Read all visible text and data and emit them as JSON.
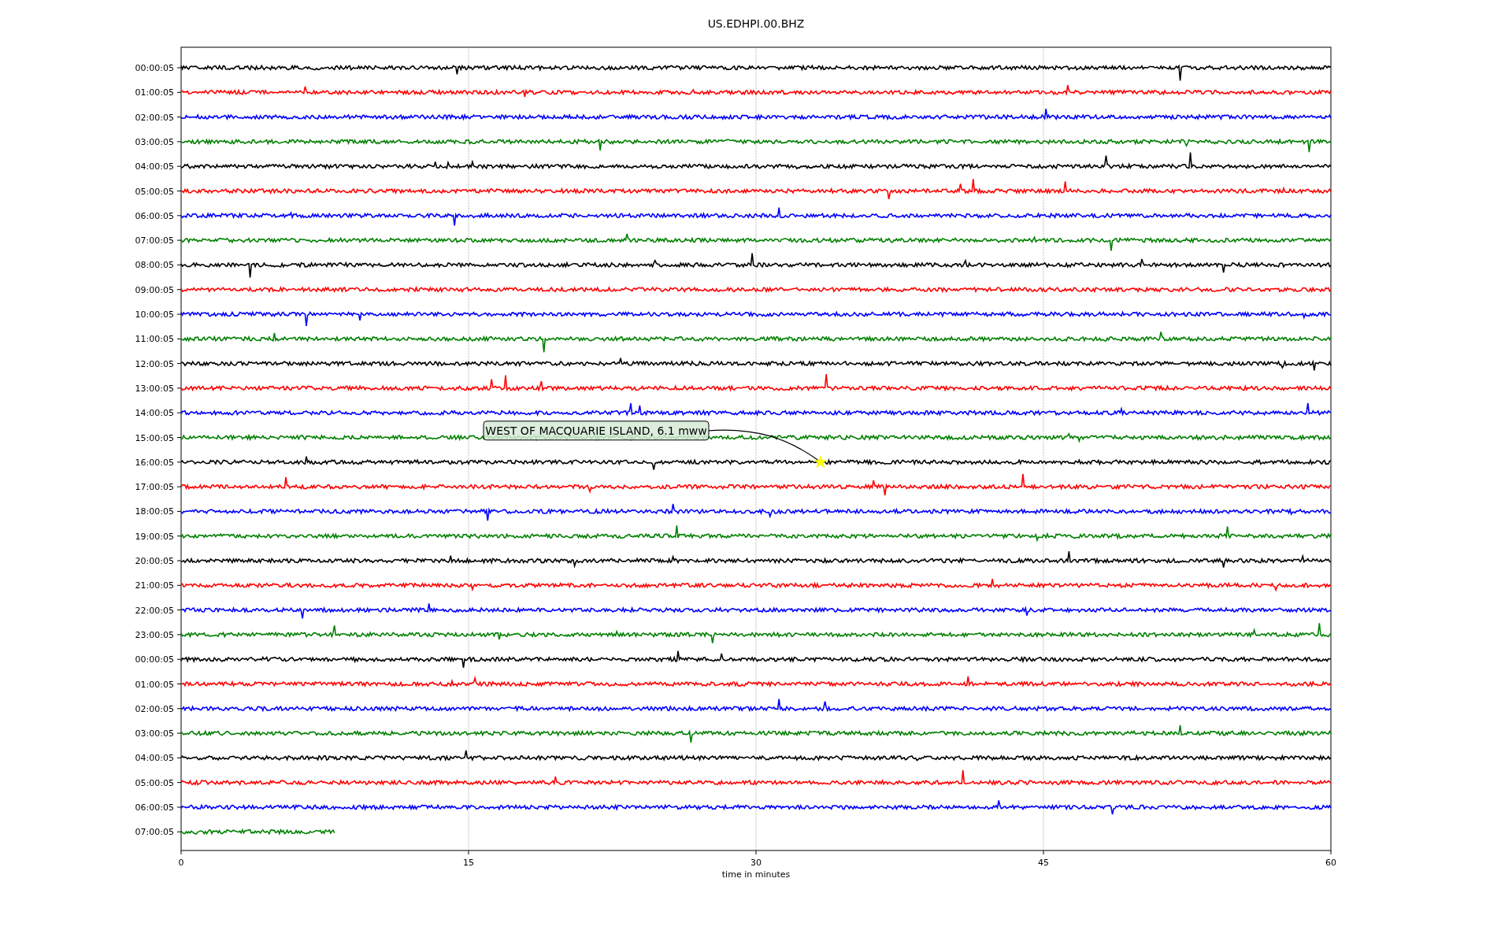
{
  "title": "US.EDHPI.00.BHZ",
  "xlabel": "time in minutes",
  "xticks": [
    "0",
    "15",
    "30",
    "45",
    "60"
  ],
  "traces": [
    {
      "label": "00:00:05",
      "color": "#000000",
      "level": 1
    },
    {
      "label": "01:00:05",
      "color": "#ff0000",
      "level": 1
    },
    {
      "label": "02:00:05",
      "color": "#0000ff",
      "level": 1
    },
    {
      "label": "03:00:05",
      "color": "#008000",
      "level": 1
    },
    {
      "label": "04:00:05",
      "color": "#000000",
      "level": 1
    },
    {
      "label": "05:00:05",
      "color": "#ff0000",
      "level": 1
    },
    {
      "label": "06:00:05",
      "color": "#0000ff",
      "level": 1
    },
    {
      "label": "07:00:05",
      "color": "#008000",
      "level": 1
    },
    {
      "label": "08:00:05",
      "color": "#000000",
      "level": 1
    },
    {
      "label": "09:00:05",
      "color": "#ff0000",
      "level": 1
    },
    {
      "label": "10:00:05",
      "color": "#0000ff",
      "level": 1
    },
    {
      "label": "11:00:05",
      "color": "#008000",
      "level": 1
    },
    {
      "label": "12:00:05",
      "color": "#000000",
      "level": 1
    },
    {
      "label": "13:00:05",
      "color": "#ff0000",
      "level": 1
    },
    {
      "label": "14:00:05",
      "color": "#0000ff",
      "level": 1
    },
    {
      "label": "15:00:05",
      "color": "#008000",
      "level": 1
    },
    {
      "label": "16:00:05",
      "color": "#000000",
      "level": 1,
      "event": "WEST OF MACQUARIE ISLAND, 6.1 mww"
    },
    {
      "label": "17:00:05",
      "color": "#ff0000",
      "level": 1
    },
    {
      "label": "18:00:05",
      "color": "#0000ff",
      "level": 1
    },
    {
      "label": "19:00:05",
      "color": "#008000",
      "level": 1
    },
    {
      "label": "20:00:05",
      "color": "#000000",
      "level": 1
    },
    {
      "label": "21:00:05",
      "color": "#ff0000",
      "level": 1
    },
    {
      "label": "22:00:05",
      "color": "#0000ff",
      "level": 1
    },
    {
      "label": "23:00:05",
      "color": "#008000",
      "level": 1
    },
    {
      "label": "00:00:05",
      "color": "#000000",
      "level": 1
    },
    {
      "label": "01:00:05",
      "color": "#ff0000",
      "level": 1
    },
    {
      "label": "02:00:05",
      "color": "#0000ff",
      "level": 1
    },
    {
      "label": "03:00:05",
      "color": "#008000",
      "level": 1
    },
    {
      "label": "04:00:05",
      "color": "#000000",
      "level": 1
    },
    {
      "label": "05:00:05",
      "color": "#ff0000",
      "level": 1
    },
    {
      "label": "06:00:05",
      "color": "#0000ff",
      "level": 1
    },
    {
      "label": "07:00:05",
      "color": "#008000",
      "level": 0.133
    }
  ]
}
